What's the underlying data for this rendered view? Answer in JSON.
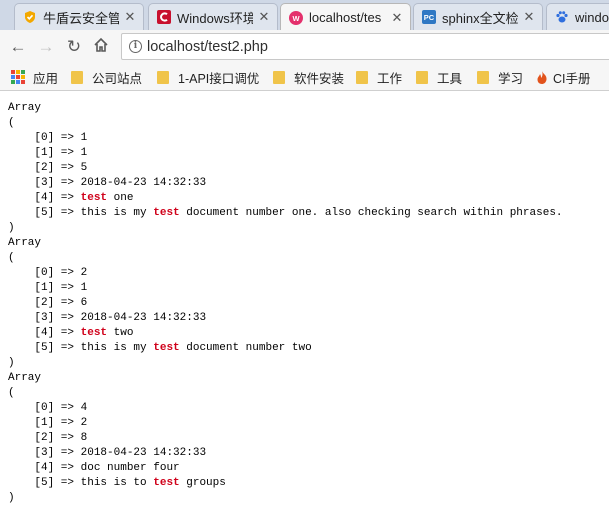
{
  "tabs": [
    {
      "title": "牛盾云安全管",
      "icon": "shield-icon",
      "icon_color": "#f3a800"
    },
    {
      "title": "Windows环境",
      "icon": "c-logo-icon",
      "icon_color": "#c8102e"
    },
    {
      "title": "localhost/tes",
      "icon": "php-icon",
      "icon_color": "#e4306c",
      "active": true
    },
    {
      "title": "sphinx全文检",
      "icon": "pc-icon",
      "icon_color": "#2f78c4"
    },
    {
      "title": "windo",
      "icon": "paw-icon",
      "icon_color": "#2f6fde"
    }
  ],
  "address": {
    "url": "localhost/test2.php"
  },
  "bookmarks": [
    {
      "label": "应用",
      "icon": "apps-grid-icon"
    },
    {
      "label": "公司站点",
      "icon": "folder-icon"
    },
    {
      "label": "1-API接口调优",
      "icon": "folder-icon"
    },
    {
      "label": "软件安装",
      "icon": "folder-icon"
    },
    {
      "label": "工作",
      "icon": "folder-icon"
    },
    {
      "label": "工具",
      "icon": "folder-icon"
    },
    {
      "label": "学习",
      "icon": "folder-icon"
    },
    {
      "label": "CI手册",
      "icon": "flame-icon"
    }
  ],
  "colors": {
    "highlight": "#d0021b",
    "folder": "#f0c44a"
  },
  "results": [
    {
      "header": "Array",
      "open": "(",
      "close": ")",
      "fields": [
        {
          "key": "[0] => ",
          "parts": [
            {
              "text": "1"
            }
          ]
        },
        {
          "key": "[1] => ",
          "parts": [
            {
              "text": "1"
            }
          ]
        },
        {
          "key": "[2] => ",
          "parts": [
            {
              "text": "5"
            }
          ]
        },
        {
          "key": "[3] => ",
          "parts": [
            {
              "text": "2018-04-23 14:32:33"
            }
          ]
        },
        {
          "key": "[4] => ",
          "parts": [
            {
              "text": "test",
              "hl": true
            },
            {
              "text": " one"
            }
          ]
        },
        {
          "key": "[5] => ",
          "parts": [
            {
              "text": "this is my "
            },
            {
              "text": "test",
              "hl": true
            },
            {
              "text": " document number one. also checking search within phrases."
            }
          ]
        }
      ]
    },
    {
      "header": "Array",
      "open": "(",
      "close": ")",
      "fields": [
        {
          "key": "[0] => ",
          "parts": [
            {
              "text": "2"
            }
          ]
        },
        {
          "key": "[1] => ",
          "parts": [
            {
              "text": "1"
            }
          ]
        },
        {
          "key": "[2] => ",
          "parts": [
            {
              "text": "6"
            }
          ]
        },
        {
          "key": "[3] => ",
          "parts": [
            {
              "text": "2018-04-23 14:32:33"
            }
          ]
        },
        {
          "key": "[4] => ",
          "parts": [
            {
              "text": "test",
              "hl": true
            },
            {
              "text": " two"
            }
          ]
        },
        {
          "key": "[5] => ",
          "parts": [
            {
              "text": "this is my "
            },
            {
              "text": "test",
              "hl": true
            },
            {
              "text": " document number two"
            }
          ]
        }
      ]
    },
    {
      "header": "Array",
      "open": "(",
      "close": ")",
      "fields": [
        {
          "key": "[0] => ",
          "parts": [
            {
              "text": "4"
            }
          ]
        },
        {
          "key": "[1] => ",
          "parts": [
            {
              "text": "2"
            }
          ]
        },
        {
          "key": "[2] => ",
          "parts": [
            {
              "text": "8"
            }
          ]
        },
        {
          "key": "[3] => ",
          "parts": [
            {
              "text": "2018-04-23 14:32:33"
            }
          ]
        },
        {
          "key": "[4] => ",
          "parts": [
            {
              "text": "doc number four"
            }
          ]
        },
        {
          "key": "[5] => ",
          "parts": [
            {
              "text": "this is to "
            },
            {
              "text": "test",
              "hl": true
            },
            {
              "text": " groups"
            }
          ]
        }
      ]
    }
  ]
}
